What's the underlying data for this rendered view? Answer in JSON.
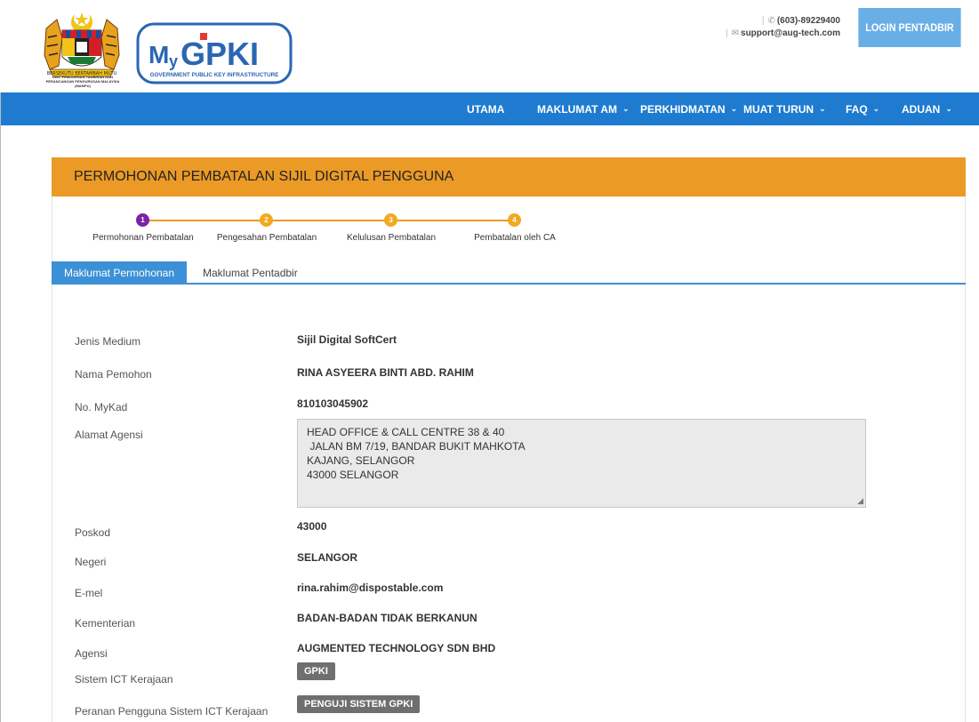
{
  "header": {
    "crest_caption": "UNIT PEMODENAN TADBIRAN DAN PERANCANGAN PENGURUSAN MALAYSIA (MAMPU)",
    "logo_text": "MyGPKI",
    "logo_subtitle": "GOVERNMENT PUBLIC KEY INFRASTRUCTURE",
    "phone": "(603)-89229400",
    "email": "support@aug-tech.com",
    "login_label": "LOGIN PENTADBIR"
  },
  "nav": {
    "items": [
      {
        "label": "UTAMA",
        "dropdown": false
      },
      {
        "label": "MAKLUMAT AM",
        "dropdown": true
      },
      {
        "label": "PERKHIDMATAN",
        "dropdown": true
      },
      {
        "label": "MUAT TURUN",
        "dropdown": true
      },
      {
        "label": "FAQ",
        "dropdown": true
      },
      {
        "label": "ADUAN",
        "dropdown": true
      }
    ],
    "chevron": "⌄"
  },
  "panel": {
    "title": "PERMOHONAN PEMBATALAN SIJIL DIGITAL PENGGUNA"
  },
  "steps": [
    {
      "number": "1",
      "label": "Permohonan Pembatalan",
      "state": "active"
    },
    {
      "number": "2",
      "label": "Pengesahan Pembatalan",
      "state": "pending"
    },
    {
      "number": "3",
      "label": "Kelulusan Pembatalan",
      "state": "pending"
    },
    {
      "number": "4",
      "label": "Pembatalan oleh CA",
      "state": "pending"
    }
  ],
  "tabs": [
    {
      "label": "Maklumat Permohonan",
      "active": true
    },
    {
      "label": "Maklumat Pentadbir",
      "active": false
    }
  ],
  "form": {
    "jenis_medium": {
      "label": "Jenis Medium",
      "value": "Sijil Digital SoftCert"
    },
    "nama": {
      "label": "Nama Pemohon",
      "value": "RINA ASYEERA BINTI ABD. RAHIM"
    },
    "mykad": {
      "label": "No. MyKad",
      "value": "810103045902"
    },
    "alamat": {
      "label": "Alamat Agensi",
      "lines": [
        "HEAD OFFICE & CALL CENTRE 38 & 40",
        " JALAN BM 7/19, BANDAR BUKIT MAHKOTA",
        "KAJANG, SELANGOR",
        "43000 SELANGOR"
      ]
    },
    "poskod": {
      "label": "Poskod",
      "value": "43000"
    },
    "negeri": {
      "label": "Negeri",
      "value": "SELANGOR"
    },
    "emel": {
      "label": "E-mel",
      "value": "rina.rahim@dispostable.com"
    },
    "kementerian": {
      "label": "Kementerian",
      "value": "BADAN-BADAN TIDAK BERKANUN"
    },
    "agensi": {
      "label": "Agensi",
      "value": "AUGMENTED TECHNOLOGY SDN BHD"
    },
    "sistem": {
      "label": "Sistem ICT Kerajaan",
      "value": "GPKI"
    },
    "peranan": {
      "label": "Peranan Pengguna Sistem ICT Kerajaan",
      "value": "PENGUJI SISTEM GPKI"
    }
  },
  "colors": {
    "nav_bg": "#1e7bd0",
    "panel_head": "#ec9a26",
    "step_active": "#7a22a8",
    "step_pending": "#f3a91e",
    "tab_active": "#3c90d6"
  }
}
